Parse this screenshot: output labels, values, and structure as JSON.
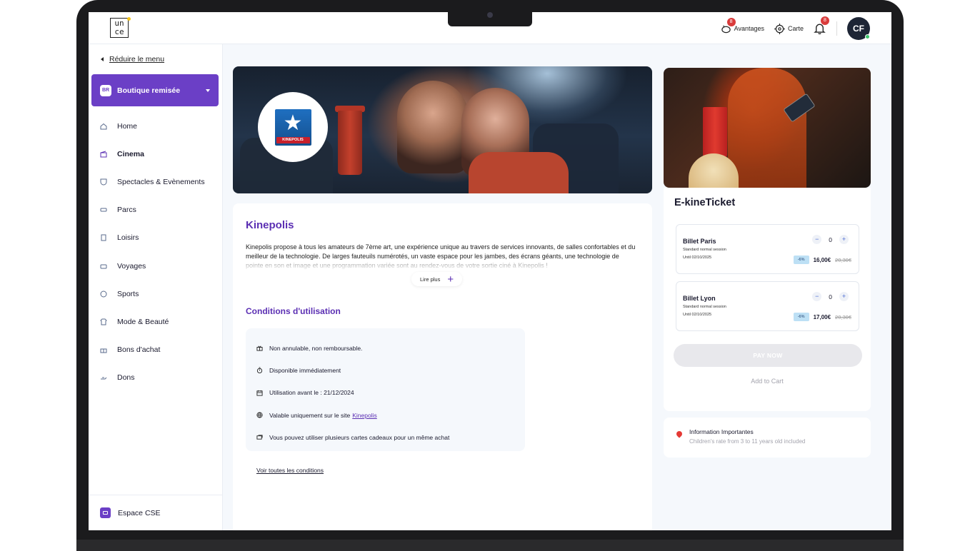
{
  "topbar": {
    "logo_text": "un\nce",
    "advantages_label": "Avantages",
    "advantages_badge": "8",
    "map_label": "Carte",
    "notifications_badge": "8",
    "avatar_initials": "CF"
  },
  "sidebar": {
    "reduce_label": "Réduire le menu",
    "shop_badge": "BR",
    "shop_label": "Boutique remisée",
    "items": [
      {
        "label": "Home",
        "icon": "home-icon"
      },
      {
        "label": "Cinema",
        "icon": "cinema-icon"
      },
      {
        "label": "Spectacles & Evènements",
        "icon": "theater-icon"
      },
      {
        "label": "Parcs",
        "icon": "ticket-icon"
      },
      {
        "label": "Loisirs",
        "icon": "leisure-icon"
      },
      {
        "label": "Voyages",
        "icon": "travel-icon"
      },
      {
        "label": "Sports",
        "icon": "sports-icon"
      },
      {
        "label": "Mode & Beauté",
        "icon": "fashion-icon"
      },
      {
        "label": "Bons d'achat",
        "icon": "gift-icon"
      },
      {
        "label": "Dons",
        "icon": "donation-icon"
      }
    ],
    "active_item": "Cinema",
    "footer_label": "Espace CSE"
  },
  "hero": {
    "brand_logo_text": "KINEPOLIS"
  },
  "content": {
    "title": "Kinepolis",
    "description": "Kinepolis propose à tous les amateurs de 7ème art, une expérience unique au travers de services innovants, de salles confortables et du meilleur de la technologie. De larges fauteuils numérotés, un vaste espace pour les jambes, des écrans géants, une technologie de pointe en son et image et une programmation variée sont au rendez-vous de votre sortie ciné à Kinepolis !",
    "read_more_label": "Lire plus",
    "conditions_title": "Conditions d'utilisation",
    "conditions": [
      {
        "text": "Non annulable, non remboursable.",
        "icon": "gift-icon"
      },
      {
        "text": "Disponible immédiatement",
        "icon": "stopwatch-icon"
      },
      {
        "text": "Utilisation avant le : 21/12/2024",
        "icon": "calendar-icon"
      },
      {
        "text": "Valable uniquement sur le site",
        "link": "Kinepolis",
        "icon": "globe-icon"
      },
      {
        "text": "Vous pouvez utiliser plusieurs cartes cadeaux pour un même achat",
        "icon": "cards-icon"
      }
    ],
    "all_conditions_label": "Voir toutes les conditions"
  },
  "ticket": {
    "title": "E-kineTicket",
    "offers": [
      {
        "name": "Billet Paris",
        "subtitle": "Standard normal session",
        "until": "Until 02/10/2025",
        "qty": "0",
        "discount": "-6%",
        "price": "16,00€",
        "old_price": "20,30€"
      },
      {
        "name": "Billet Lyon",
        "subtitle": "Standard normal session",
        "until": "Until 02/10/2025",
        "qty": "0",
        "discount": "-6%",
        "price": "17,00€",
        "old_price": "20,30€"
      }
    ],
    "pay_label": "PAY NOW",
    "cart_label": "Add to Cart"
  },
  "info": {
    "title": "Information Importantes",
    "subtitle": "Children's rate from 3 to 11 years old included"
  },
  "colors": {
    "accent": "#6b3fc6",
    "title_purple": "#5b2fb3",
    "badge_red": "#d93b3b"
  }
}
